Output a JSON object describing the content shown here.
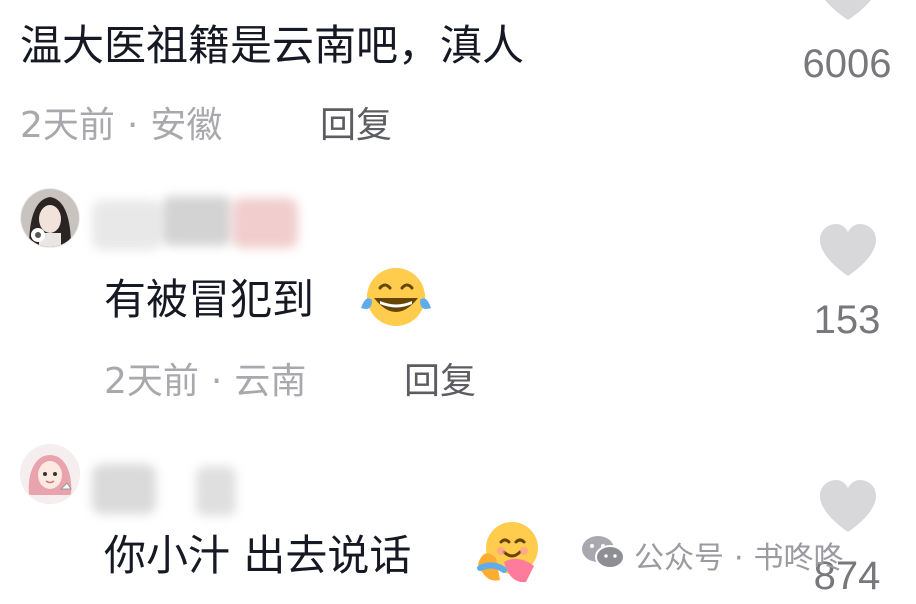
{
  "comments": [
    {
      "text": "温大医祖籍是云南吧，滇人",
      "time": "2天前",
      "location": "安徽",
      "reply_label": "回复",
      "likes": "6006"
    },
    {
      "text": "有被冒犯到",
      "emoji": "tears-of-joy-emoji",
      "time": "2天前",
      "location": "云南",
      "reply_label": "回复",
      "likes": "153"
    },
    {
      "text": "你小汁 出去说话",
      "emoji": "hugging-face-emoji",
      "likes": "874"
    }
  ],
  "meta_separator": "·",
  "watermark": {
    "source": "公众号",
    "separator": "·",
    "account": "书咚咚"
  },
  "colors": {
    "text": "#161823",
    "meta": "#a8a8ad",
    "reply": "#5c5c63",
    "like_icon": "#d8d8da",
    "like_count": "#77777c"
  }
}
